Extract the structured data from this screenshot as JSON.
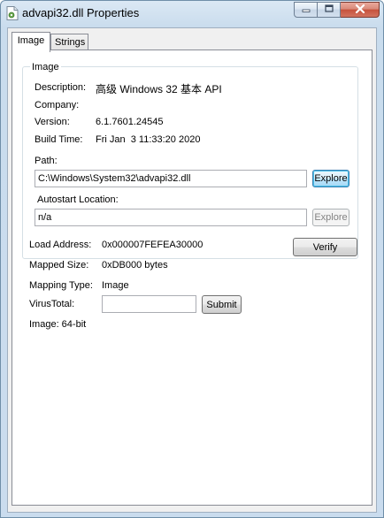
{
  "window": {
    "title": "advapi32.dll Properties"
  },
  "tabs": [
    {
      "label": "Image",
      "active": true
    },
    {
      "label": "Strings",
      "active": false
    }
  ],
  "image_group": {
    "legend": "Image",
    "description_label": "Description:",
    "description_value": "高级 Windows 32 基本 API",
    "company_label": "Company:",
    "company_value": "",
    "version_label": "Version:",
    "version_value": "6.1.7601.24545",
    "build_time_label": "Build Time:",
    "build_time_value": "Fri Jan  3 11:33:20 2020",
    "path_label": "Path:",
    "path_value": "C:\\Windows\\System32\\advapi32.dll",
    "path_explore_label": "Explore",
    "autostart_label": "Autostart Location:",
    "autostart_value": "n/a",
    "autostart_explore_label": "Explore"
  },
  "details": {
    "load_address_label": "Load Address:",
    "load_address_value": "0x000007FEFEA30000",
    "verify_label": "Verify",
    "mapped_size_label": "Mapped Size:",
    "mapped_size_value": "0xDB000 bytes",
    "mapping_type_label": "Mapping Type:",
    "mapping_type_value": "Image",
    "virustotal_label": "VirusTotal:",
    "virustotal_value": "",
    "submit_label": "Submit",
    "image_bits": "Image: 64-bit"
  },
  "icons": {
    "app": "dll-file-icon",
    "minimize": "minimize-icon",
    "maximize": "maximize-icon",
    "close": "close-icon"
  },
  "colors": {
    "titlebar": "#c9dced",
    "close_button": "#c6523c",
    "focused_button": "#3c7fb1"
  }
}
